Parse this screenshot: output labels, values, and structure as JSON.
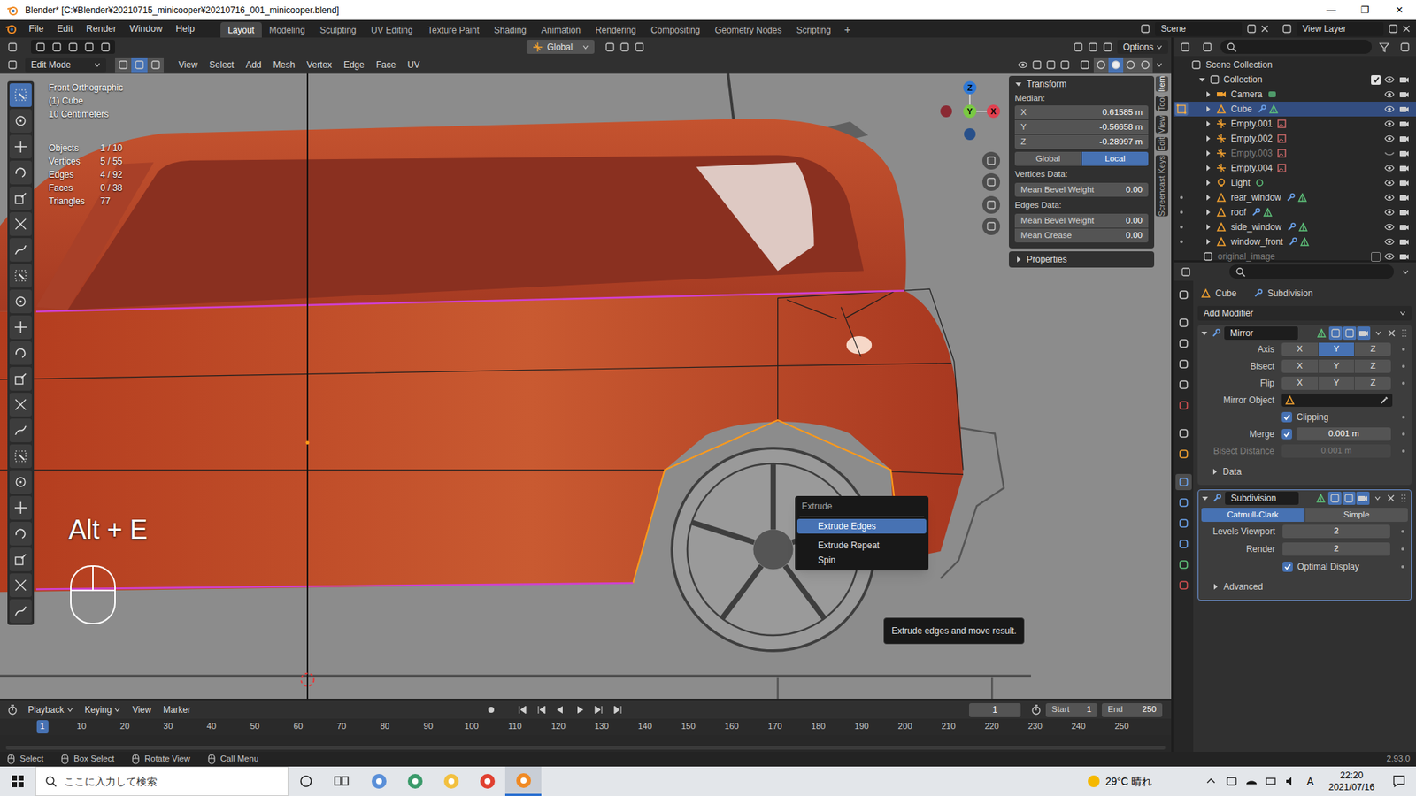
{
  "window": {
    "title": "Blender* [C:¥Blender¥20210715_minicooper¥20210716_001_minicooper.blend]",
    "controls": [
      "—",
      "❐",
      "✕"
    ]
  },
  "menu": [
    "File",
    "Edit",
    "Render",
    "Window",
    "Help"
  ],
  "workspaces": [
    {
      "label": "Layout",
      "selected": true
    },
    {
      "label": "Modeling",
      "selected": false
    },
    {
      "label": "Sculpting",
      "selected": false
    },
    {
      "label": "UV Editing",
      "selected": false
    },
    {
      "label": "Texture Paint",
      "selected": false
    },
    {
      "label": "Shading",
      "selected": false
    },
    {
      "label": "Animation",
      "selected": false
    },
    {
      "label": "Rendering",
      "selected": false
    },
    {
      "label": "Compositing",
      "selected": false
    },
    {
      "label": "Geometry Nodes",
      "selected": false
    },
    {
      "label": "Scripting",
      "selected": false
    }
  ],
  "add_workspace": "+",
  "scene": "Scene",
  "view_layer": "View Layer",
  "tool_header": {
    "orientation": "Global",
    "options": "Options"
  },
  "mode_header": {
    "mode": "Edit Mode",
    "select_modes": [
      {
        "selected": false
      },
      {
        "selected": true
      },
      {
        "selected": false
      }
    ],
    "menus": [
      "View",
      "Select",
      "Add",
      "Mesh",
      "Vertex",
      "Edge",
      "Face",
      "UV"
    ],
    "shading": [
      {
        "selected": false
      },
      {
        "selected": true
      },
      {
        "selected": false
      },
      {
        "selected": false
      }
    ]
  },
  "toolbar": [
    {
      "selected": true
    },
    {
      "selected": false
    },
    {
      "selected": false
    },
    {
      "selected": false
    },
    {
      "selected": false
    },
    {
      "selected": false
    },
    {
      "selected": false
    },
    {
      "selected": false
    },
    {
      "selected": false
    },
    {
      "selected": false
    },
    {
      "selected": false
    },
    {
      "selected": false
    },
    {
      "selected": false
    },
    {
      "selected": false
    },
    {
      "selected": false
    },
    {
      "selected": false
    },
    {
      "selected": false
    },
    {
      "selected": false
    },
    {
      "selected": false
    },
    {
      "selected": false
    },
    {
      "selected": false
    }
  ],
  "viewport": {
    "view": "Front Orthographic",
    "object": "(1) Cube",
    "scale": "10 Centimeters",
    "stats": [
      {
        "label": "Objects",
        "value": "1 / 10"
      },
      {
        "label": "Vertices",
        "value": "5 / 55"
      },
      {
        "label": "Edges",
        "value": "4 / 92"
      },
      {
        "label": "Faces",
        "value": "0 / 38"
      },
      {
        "label": "Triangles",
        "value": "77"
      }
    ],
    "gizmo": {
      "x": "X",
      "y": "Y",
      "z": "Z"
    }
  },
  "screencast": "Alt + E",
  "extrude_menu": {
    "title": "Extrude",
    "items": [
      {
        "label": "Extrude Edges",
        "selected": true
      },
      {
        "label": "Extrude Repeat",
        "selected": false
      },
      {
        "label": "Spin",
        "selected": false
      }
    ],
    "tooltip": "Extrude edges and move result."
  },
  "n_panel": {
    "section": "Transform",
    "median_label": "Median:",
    "fields": [
      {
        "label": "X",
        "value": "0.61585 m"
      },
      {
        "label": "Y",
        "value": "-0.56658 m"
      },
      {
        "label": "Z",
        "value": "-0.28997 m"
      }
    ],
    "space": [
      {
        "label": "Global",
        "selected": false
      },
      {
        "label": "Local",
        "selected": true
      }
    ],
    "vertices_label": "Vertices Data:",
    "vertex_fields": [
      {
        "label": "Mean Bevel Weight",
        "value": "0.00"
      }
    ],
    "edges_label": "Edges Data:",
    "edge_fields": [
      {
        "label": "Mean Bevel Weight",
        "value": "0.00"
      },
      {
        "label": "Mean Crease",
        "value": "0.00"
      }
    ],
    "properties": "Properties",
    "tabs": [
      {
        "label": "Item",
        "selected": true
      },
      {
        "label": "Tool",
        "selected": false
      },
      {
        "label": "View",
        "selected": false
      },
      {
        "label": "Edit",
        "selected": false
      },
      {
        "label": "Screencast Keys",
        "selected": false
      }
    ]
  },
  "outliner": {
    "root": "Scene Collection",
    "collection": {
      "label": "Collection",
      "checked": true
    },
    "items": [
      {
        "label": "Camera",
        "kind": "camera",
        "selected": false,
        "dimmed": false,
        "visible": true,
        "edit_mode": false,
        "can_edit": false
      },
      {
        "label": "Cube",
        "kind": "mesh",
        "selected": true,
        "dimmed": false,
        "visible": true,
        "edit_mode": true,
        "can_edit": false
      },
      {
        "label": "Empty.001",
        "kind": "empty",
        "selected": false,
        "dimmed": false,
        "visible": true,
        "edit_mode": false,
        "can_edit": false
      },
      {
        "label": "Empty.002",
        "kind": "empty",
        "selected": false,
        "dimmed": false,
        "visible": true,
        "edit_mode": false,
        "can_edit": false
      },
      {
        "label": "Empty.003",
        "kind": "empty",
        "selected": false,
        "dimmed": true,
        "visible": false,
        "edit_mode": false,
        "can_edit": false
      },
      {
        "label": "Empty.004",
        "kind": "empty",
        "selected": false,
        "dimmed": false,
        "visible": true,
        "edit_mode": false,
        "can_edit": false
      },
      {
        "label": "Light",
        "kind": "light",
        "selected": false,
        "dimmed": false,
        "visible": true,
        "edit_mode": false,
        "can_edit": false
      },
      {
        "label": "rear_window",
        "kind": "mesh",
        "selected": false,
        "dimmed": false,
        "visible": true,
        "edit_mode": false,
        "can_edit": true
      },
      {
        "label": "roof",
        "kind": "mesh",
        "selected": false,
        "dimmed": false,
        "visible": true,
        "edit_mode": false,
        "can_edit": true
      },
      {
        "label": "side_window",
        "kind": "mesh",
        "selected": false,
        "dimmed": false,
        "visible": true,
        "edit_mode": false,
        "can_edit": true
      },
      {
        "label": "window_front",
        "kind": "mesh",
        "selected": false,
        "dimmed": false,
        "visible": true,
        "edit_mode": false,
        "can_edit": true
      }
    ],
    "excluded": {
      "label": "original_image",
      "checked": false
    }
  },
  "properties": {
    "tabs": [
      {
        "selected": false
      },
      {
        "selected": false
      },
      {
        "selected": false
      },
      {
        "selected": false
      },
      {
        "selected": false
      },
      {
        "selected": false
      },
      {
        "selected": false
      },
      {
        "selected": false
      },
      {
        "selected": true
      },
      {
        "selected": false
      },
      {
        "selected": false
      },
      {
        "selected": false
      },
      {
        "selected": false
      },
      {
        "selected": false
      }
    ],
    "breadcrumb": [
      "Cube",
      "Subdivision"
    ],
    "add_modifier": "Add Modifier",
    "mirror": {
      "name": "Mirror",
      "rows": [
        {
          "label": "Axis",
          "options": [
            {
              "label": "X",
              "selected": false
            },
            {
              "label": "Y",
              "selected": true
            },
            {
              "label": "Z",
              "selected": false
            }
          ]
        },
        {
          "label": "Bisect",
          "options": [
            {
              "label": "X",
              "selected": false
            },
            {
              "label": "Y",
              "selected": false
            },
            {
              "label": "Z",
              "selected": false
            }
          ]
        },
        {
          "label": "Flip",
          "options": [
            {
              "label": "X",
              "selected": false
            },
            {
              "label": "Y",
              "selected": false
            },
            {
              "label": "Z",
              "selected": false
            }
          ]
        }
      ],
      "mirror_object": "Mirror Object",
      "clipping": {
        "label": "Clipping",
        "checked": true
      },
      "merge": {
        "label": "Merge",
        "checked": true,
        "value": "0.001 m"
      },
      "bisect_distance": {
        "label": "Bisect Distance",
        "value": "0.001 m",
        "disabled": true
      },
      "data": "Data"
    },
    "subdivision": {
      "name": "Subdivision",
      "types": [
        {
          "label": "Catmull-Clark",
          "selected": true
        },
        {
          "label": "Simple",
          "selected": false
        }
      ],
      "levels_viewport": {
        "label": "Levels Viewport",
        "value": "2"
      },
      "render": {
        "label": "Render",
        "value": "2"
      },
      "optimal_display": {
        "label": "Optimal Display",
        "checked": true
      },
      "advanced": "Advanced"
    }
  },
  "timeline": {
    "menus": [
      "Playback",
      "Keying",
      "View",
      "Marker"
    ],
    "current_frame": "1",
    "start_label": "Start",
    "start": "1",
    "end_label": "End",
    "end": "250",
    "ticks": [
      {
        "label": "1",
        "selected": true
      },
      {
        "label": "10",
        "selected": false
      },
      {
        "label": "20",
        "selected": false
      },
      {
        "label": "30",
        "selected": false
      },
      {
        "label": "40",
        "selected": false
      },
      {
        "label": "50",
        "selected": false
      },
      {
        "label": "60",
        "selected": false
      },
      {
        "label": "70",
        "selected": false
      },
      {
        "label": "80",
        "selected": false
      },
      {
        "label": "90",
        "selected": false
      },
      {
        "label": "100",
        "selected": false
      },
      {
        "label": "110",
        "selected": false
      },
      {
        "label": "120",
        "selected": false
      },
      {
        "label": "130",
        "selected": false
      },
      {
        "label": "140",
        "selected": false
      },
      {
        "label": "150",
        "selected": false
      },
      {
        "label": "160",
        "selected": false
      },
      {
        "label": "170",
        "selected": false
      },
      {
        "label": "180",
        "selected": false
      },
      {
        "label": "190",
        "selected": false
      },
      {
        "label": "200",
        "selected": false
      },
      {
        "label": "210",
        "selected": false
      },
      {
        "label": "220",
        "selected": false
      },
      {
        "label": "230",
        "selected": false
      },
      {
        "label": "240",
        "selected": false
      },
      {
        "label": "250",
        "selected": false
      }
    ]
  },
  "status_bar": {
    "items": [
      "Select",
      "Box Select",
      "Rotate View",
      "Call Menu"
    ],
    "version": "2.93.0"
  },
  "taskbar": {
    "search": "ここに入力して検索",
    "weather": "29°C 晴れ",
    "ime": "A",
    "time": "22:20",
    "date": "2021/07/16",
    "apps": [
      {
        "selected": false
      },
      {
        "selected": false
      },
      {
        "selected": false
      },
      {
        "selected": false
      },
      {
        "selected": true
      }
    ]
  }
}
